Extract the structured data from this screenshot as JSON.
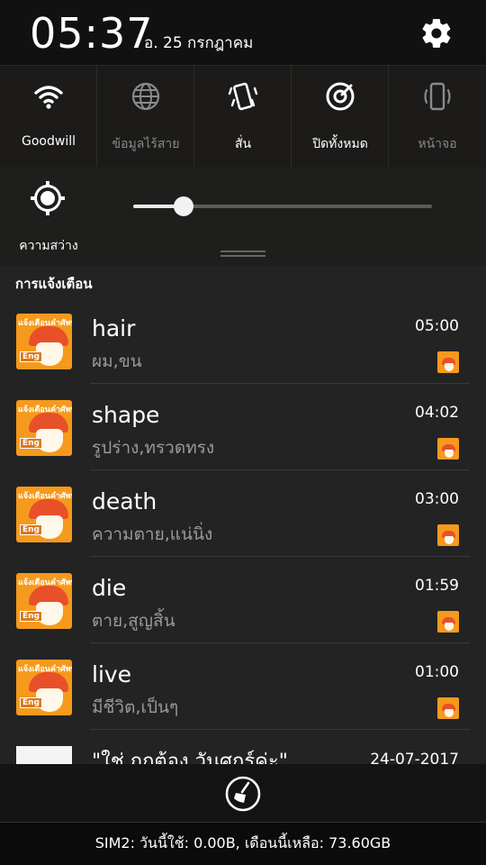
{
  "status": {
    "time": "05:37",
    "date": "อ. 25 กรกฎาคม"
  },
  "quick_settings": [
    {
      "label": "Goodwill",
      "icon": "wifi-icon",
      "active": true
    },
    {
      "label": "ข้อมูลไร้สาย",
      "icon": "globe-icon",
      "active": false
    },
    {
      "label": "สั่น",
      "icon": "vibrate-icon",
      "active": true
    },
    {
      "label": "ปิดทั้งหมด",
      "icon": "do-not-disturb-icon",
      "active": true
    },
    {
      "label": "หน้าจอ",
      "icon": "screen-rotate-icon",
      "active": false
    }
  ],
  "brightness": {
    "label": "ความสว่าง",
    "level": 0.17
  },
  "notifications": {
    "header": "การแจ้งเตือน",
    "app_icon_title": "แจ้งเตือนคำศัพท์",
    "app_icon_badge": "Eng",
    "items": [
      {
        "title": "hair",
        "subtitle": "ผม,ขน",
        "time": "05:00"
      },
      {
        "title": "shape",
        "subtitle": "รูปร่าง,ทรวดทรง",
        "time": "04:02"
      },
      {
        "title": "death",
        "subtitle": "ความตาย,แน่นิ่ง",
        "time": "03:00"
      },
      {
        "title": "die",
        "subtitle": "ตาย,สูญสิ้น",
        "time": "01:59"
      },
      {
        "title": "live",
        "subtitle": "มีชีวิต,เป็นๆ",
        "time": "01:00"
      }
    ],
    "partial": {
      "title": "\"ใช่ ถูกต้อง วันศุกร์ค่ะ\"",
      "time": "24-07-2017"
    }
  },
  "footer": {
    "sim_text": "SIM2: วันนี้ใช้: 0.00B, เดือนนี้เหลือ: 73.60GB"
  }
}
